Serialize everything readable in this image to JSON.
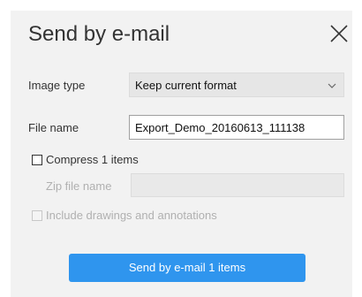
{
  "dialog": {
    "title": "Send by e-mail",
    "image_type_label": "Image type",
    "image_type_value": "Keep current format",
    "file_name_label": "File name",
    "file_name_value": "Export_Demo_20160613_111138",
    "compress_label": "Compress 1 items",
    "compress_checked": false,
    "zip_file_name_label": "Zip file name",
    "zip_file_name_value": "",
    "include_drawings_label": "Include drawings and annotations",
    "include_drawings_checked": false,
    "send_button_label": "Send by e-mail 1 items",
    "colors": {
      "panel_bg": "#f2f2f2",
      "button_bg": "#2f95ee",
      "button_text": "#ffffff",
      "disabled_text": "#b0b0b0"
    },
    "icons": {
      "close": "close-icon",
      "dropdown": "chevron-down-icon"
    }
  }
}
